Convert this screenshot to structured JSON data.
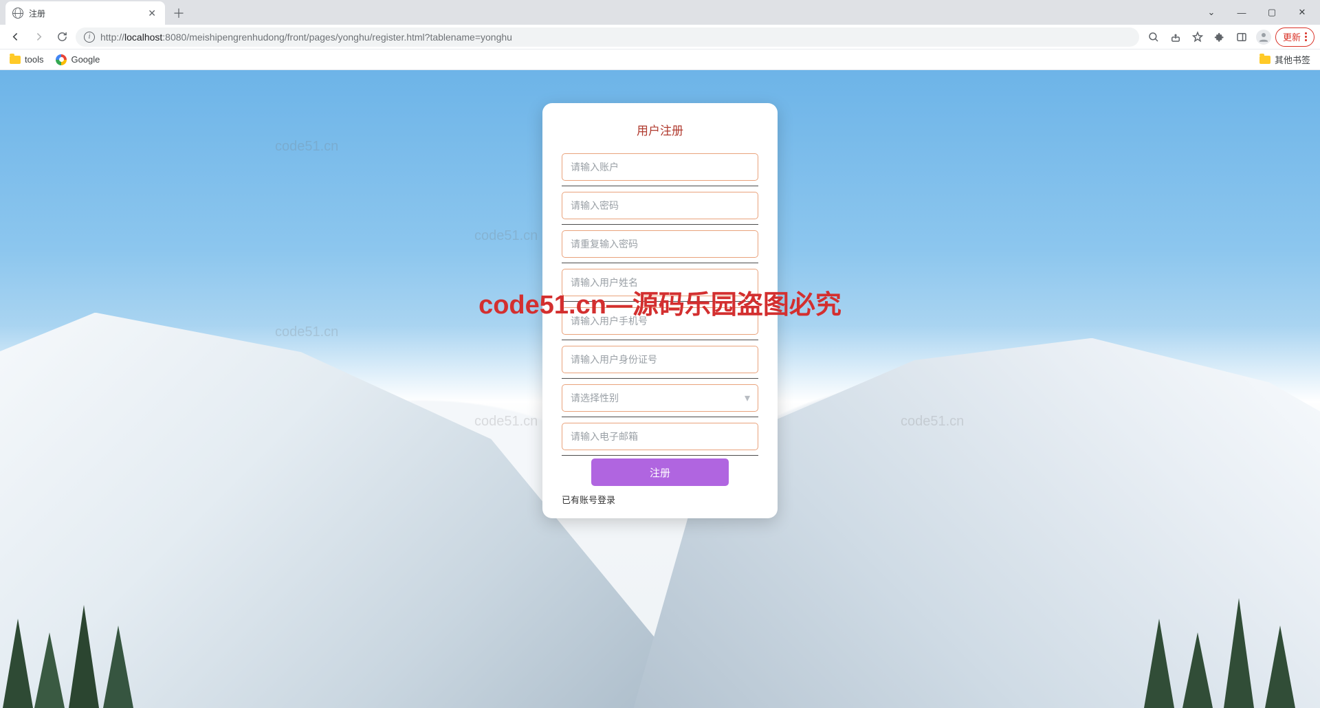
{
  "browser": {
    "tab_title": "注册",
    "url_host": "localhost",
    "url_port_path": ":8080/meishipengrenhudong/front/pages/yonghu/register.html?tablename=yonghu",
    "update_label": "更新",
    "bookmarks": {
      "tools": "tools",
      "google": "Google",
      "other": "其他书签"
    }
  },
  "watermark": {
    "text": "code51.cn",
    "center_text": "code51.cn—源码乐园盗图必究"
  },
  "form": {
    "title": "用户注册",
    "fields": {
      "account": {
        "placeholder": "请输入账户"
      },
      "password": {
        "placeholder": "请输入密码"
      },
      "password2": {
        "placeholder": "请重复输入密码"
      },
      "realname": {
        "placeholder": "请输入用户姓名"
      },
      "phone": {
        "placeholder": "请输入用户手机号"
      },
      "idcard": {
        "placeholder": "请输入用户身份证号"
      },
      "gender": {
        "placeholder": "请选择性别"
      },
      "email": {
        "placeholder": "请输入电子邮箱"
      }
    },
    "submit_label": "注册",
    "login_link_label": "已有账号登录"
  }
}
